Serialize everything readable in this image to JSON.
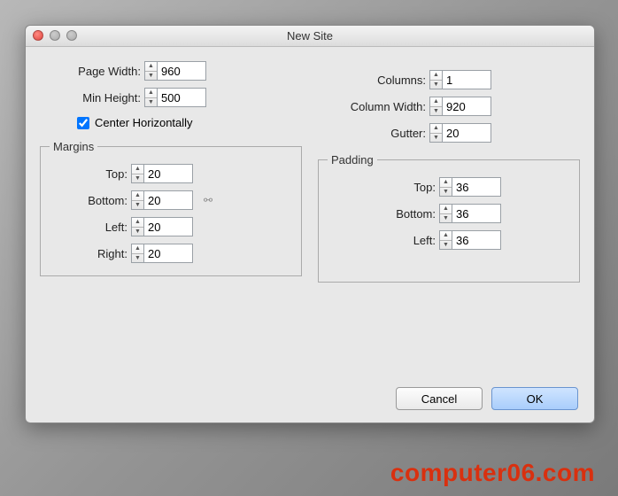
{
  "window": {
    "title": "New Site"
  },
  "page_settings": {
    "page_width_label": "Page Width:",
    "page_width": "960",
    "min_height_label": "Min Height:",
    "min_height": "500",
    "center_horizontally_label": "Center Horizontally",
    "center_horizontally_checked": true
  },
  "columns_settings": {
    "columns_label": "Columns:",
    "columns": "1",
    "column_width_label": "Column Width:",
    "column_width": "920",
    "gutter_label": "Gutter:",
    "gutter": "20"
  },
  "margins": {
    "legend": "Margins",
    "top_label": "Top:",
    "top": "20",
    "bottom_label": "Bottom:",
    "bottom": "20",
    "left_label": "Left:",
    "left": "20",
    "right_label": "Right:",
    "right": "20"
  },
  "padding": {
    "legend": "Padding",
    "top_label": "Top:",
    "top": "36",
    "bottom_label": "Bottom:",
    "bottom": "36",
    "left_label": "Left:",
    "left": "36"
  },
  "buttons": {
    "cancel": "Cancel",
    "ok": "OK"
  },
  "watermark": "computer06.com"
}
